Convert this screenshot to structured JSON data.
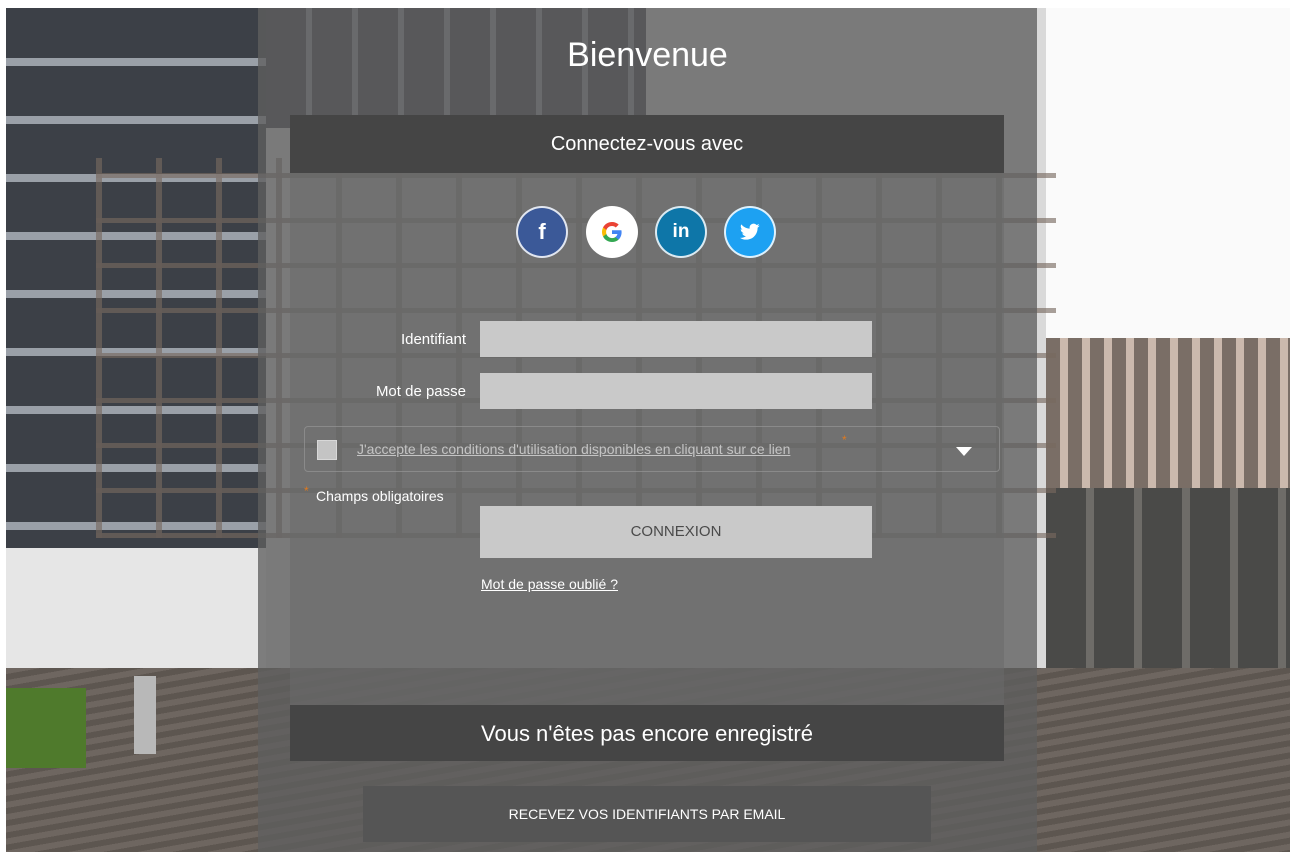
{
  "title": "Bienvenue",
  "social_login": {
    "heading": "Connectez-vous avec",
    "providers": [
      {
        "name": "Facebook",
        "icon": "facebook-icon",
        "glyph": "f",
        "color": "#3b5998"
      },
      {
        "name": "Google",
        "icon": "google-icon",
        "glyph": "G",
        "color": "#ffffff"
      },
      {
        "name": "LinkedIn",
        "icon": "linkedin-icon",
        "glyph": "in",
        "color": "#0e76a8"
      },
      {
        "name": "Twitter",
        "icon": "twitter-icon",
        "glyph": "",
        "color": "#1da1f2"
      }
    ]
  },
  "form": {
    "identifier_label": "Identifiant",
    "identifier_value": "",
    "password_label": "Mot de passe",
    "password_value": "",
    "terms_text": "J'accepte les conditions d'utilisation disponibles en cliquant sur ce lien",
    "terms_checked": false,
    "required_marker": "*",
    "required_label": "Champs obligatoires",
    "submit_label": "CONNEXION",
    "forgot_password": "Mot de passe oublié ?"
  },
  "register": {
    "heading": "Vous n'êtes pas encore enregistré",
    "button_label": "RECEVEZ VOS IDENTIFIANTS PAR EMAIL"
  },
  "colors": {
    "panel_header": "#454545",
    "input_bg": "#c9c9c9",
    "required_accent": "#e07a1f"
  }
}
